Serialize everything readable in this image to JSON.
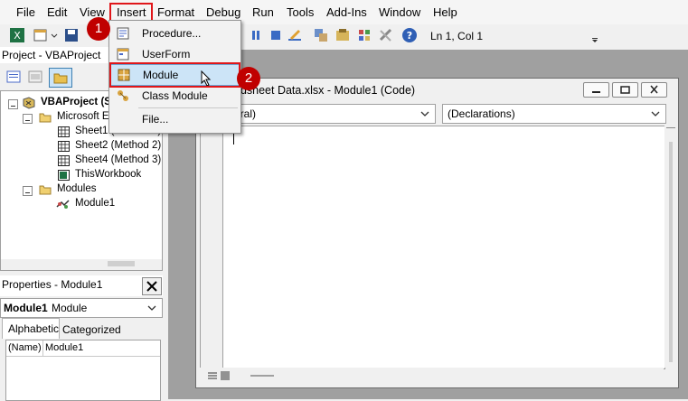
{
  "menubar": {
    "items": [
      "File",
      "Edit",
      "View",
      "Insert",
      "Format",
      "Debug",
      "Run",
      "Tools",
      "Add-Ins",
      "Window",
      "Help"
    ]
  },
  "toolbar": {
    "position": "Ln 1, Col 1"
  },
  "dropdown": {
    "items": [
      {
        "label": "Procedure...",
        "icon": "procedure-icon"
      },
      {
        "label": "UserForm",
        "icon": "userform-icon"
      },
      {
        "label": "Module",
        "icon": "module-icon"
      },
      {
        "label": "Class Module",
        "icon": "class-module-icon"
      },
      {
        "label": "File...",
        "icon": ""
      }
    ]
  },
  "badges": {
    "step1": "1",
    "step2": "2"
  },
  "project": {
    "title": "Project - VBAProject",
    "tree": {
      "root": "VBAProject (S",
      "excel_objects": "Microsoft Ex",
      "sheet1": "Sheet1 (Method 1)",
      "sheet2": "Sheet2 (Method 2)",
      "sheet4": "Sheet4 (Method 3)",
      "workbook": "ThisWorkbook",
      "modules": "Modules",
      "module1": "Module1"
    }
  },
  "properties": {
    "title": "Properties - Module1",
    "object_name": "Module1",
    "object_type": "Module",
    "tabs": [
      "Alphabetic",
      "Categorized"
    ],
    "row_name": "(Name)",
    "row_value": "Module1"
  },
  "code_window": {
    "title": "adsheet Data.xlsx - Module1 (Code)",
    "object_combo": "eral)",
    "proc_combo": "(Declarations)"
  },
  "colors": {
    "highlight": "#e0161a",
    "badge": "#c00000",
    "selection": "#cce4f7"
  }
}
